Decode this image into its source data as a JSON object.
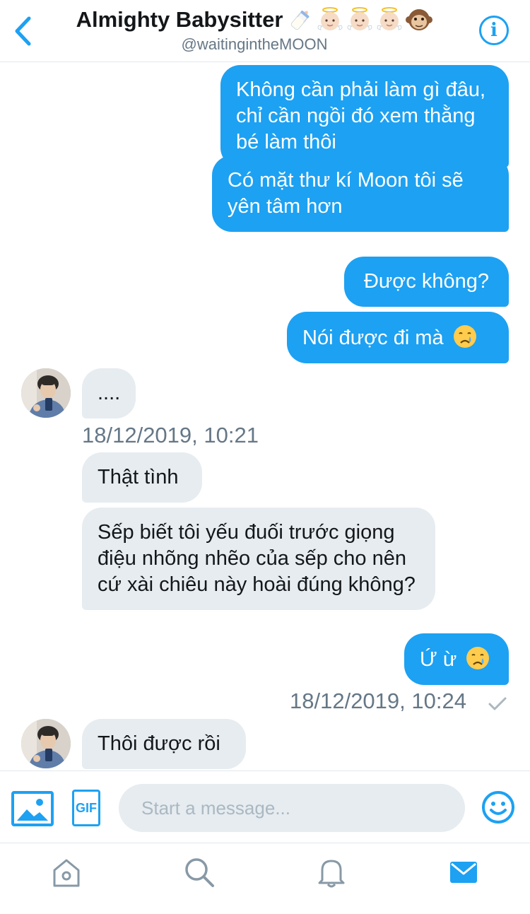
{
  "header": {
    "title": "Almighty Babysitter",
    "handle": "@waitingintheMOON",
    "title_emojis": [
      "baby-bottle-emoji",
      "baby-angel-emoji",
      "baby-angel-emoji",
      "baby-angel-emoji",
      "monkey-face-emoji"
    ],
    "back_icon": "chevron-left-icon",
    "info_label": "i"
  },
  "messages": [
    {
      "id": "m1",
      "direction": "outgoing",
      "text": "Không cần phải làm gì đâu, chỉ cần ngồi đó xem thằng bé làm thôi"
    },
    {
      "id": "m2",
      "direction": "outgoing",
      "text": "Có mặt thư kí Moon tôi sẽ yên tâm hơn"
    },
    {
      "id": "m3",
      "direction": "outgoing",
      "text": "Được không?"
    },
    {
      "id": "m4",
      "direction": "outgoing",
      "text": "Nói được đi mà",
      "emoji": "crying-face-emoji"
    },
    {
      "id": "m5",
      "direction": "incoming",
      "text": "...."
    },
    {
      "id": "m6",
      "direction": "incoming",
      "text": "Thật tình"
    },
    {
      "id": "m7",
      "direction": "incoming",
      "text": "Sếp biết tôi yếu đuối trước giọng điệu nhõng nhẽo của sếp cho nên cứ xài chiêu này hoài đúng không?"
    },
    {
      "id": "m8",
      "direction": "outgoing",
      "text": "Ứ ừ",
      "emoji": "crying-face-emoji"
    },
    {
      "id": "m9",
      "direction": "incoming",
      "text": "Thôi được rồi"
    }
  ],
  "timestamps": {
    "incoming_1": "18/12/2019, 10:21",
    "outgoing_1": "18/12/2019, 10:24"
  },
  "composer": {
    "placeholder": "Start a message...",
    "gif_label": "GIF"
  },
  "tabbar": {
    "items": [
      "home-icon",
      "search-icon",
      "notifications-icon",
      "messages-icon"
    ],
    "active": "messages-icon"
  },
  "colors": {
    "accent": "#1da1f2",
    "incoming_bubble": "#e6ecf0",
    "secondary_text": "#657786"
  }
}
